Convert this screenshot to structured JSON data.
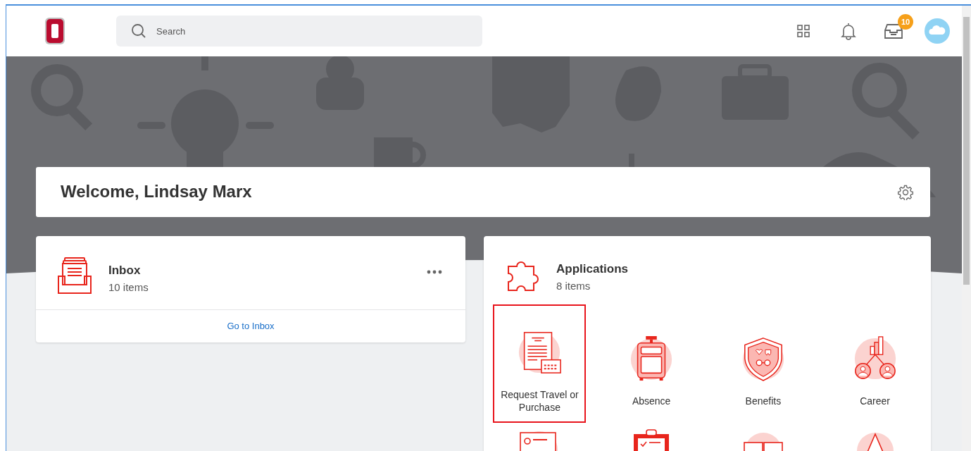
{
  "header": {
    "search": {
      "placeholder": "Search"
    },
    "inbox_badge": "10"
  },
  "welcome": {
    "title": "Welcome, Lindsay Marx"
  },
  "inbox": {
    "title": "Inbox",
    "count": "10 items",
    "link": "Go to Inbox"
  },
  "applications": {
    "title": "Applications",
    "count": "8 items",
    "apps": [
      {
        "label": "Request Travel or Purchase",
        "kind": "document",
        "highlighted": true
      },
      {
        "label": "Absence",
        "kind": "suitcase",
        "highlighted": false
      },
      {
        "label": "Benefits",
        "kind": "shield",
        "highlighted": false
      },
      {
        "label": "Career",
        "kind": "network",
        "highlighted": false
      }
    ]
  }
}
